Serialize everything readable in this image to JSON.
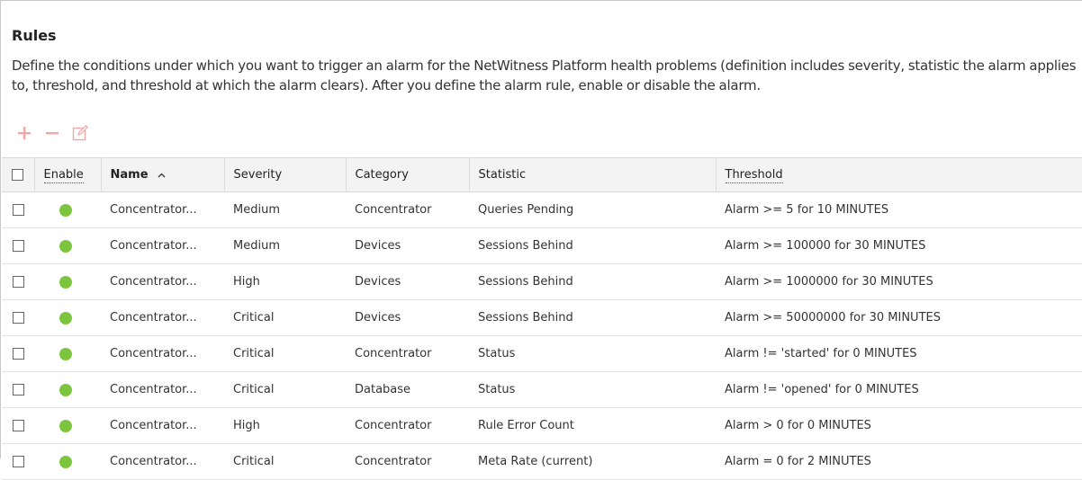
{
  "page": {
    "title": "Rules",
    "description": "Define the conditions under which you want to trigger an alarm for the NetWitness Platform health problems (definition includes severity, statistic the alarm applies to, threshold, and threshold at which the alarm clears). After you define the alarm rule, enable or disable the alarm."
  },
  "toolbar": {
    "icons": [
      "plus-icon",
      "minus-icon",
      "edit-icon"
    ],
    "icon_color": "#f2a7a7"
  },
  "colors": {
    "enabled_dot": "#7ec53f"
  },
  "table": {
    "columns": {
      "enable": "Enable",
      "name": "Name",
      "severity": "Severity",
      "category": "Category",
      "statistic": "Statistic",
      "threshold": "Threshold"
    },
    "sort_icon": "chevron-up-icon",
    "rows": [
      {
        "name": "Concentrator...",
        "severity": "Medium",
        "category": "Concentrator",
        "statistic": "Queries Pending",
        "threshold": "Alarm >= 5 for 10 MINUTES"
      },
      {
        "name": "Concentrator...",
        "severity": "Medium",
        "category": "Devices",
        "statistic": "Sessions Behind",
        "threshold": "Alarm >= 100000 for 30 MINUTES"
      },
      {
        "name": "Concentrator...",
        "severity": "High",
        "category": "Devices",
        "statistic": "Sessions Behind",
        "threshold": "Alarm >= 1000000 for 30 MINUTES"
      },
      {
        "name": "Concentrator...",
        "severity": "Critical",
        "category": "Devices",
        "statistic": "Sessions Behind",
        "threshold": "Alarm >= 50000000 for 30 MINUTES"
      },
      {
        "name": "Concentrator...",
        "severity": "Critical",
        "category": "Concentrator",
        "statistic": "Status",
        "threshold": "Alarm != 'started' for 0 MINUTES"
      },
      {
        "name": "Concentrator...",
        "severity": "Critical",
        "category": "Database",
        "statistic": "Status",
        "threshold": "Alarm != 'opened' for 0 MINUTES"
      },
      {
        "name": "Concentrator...",
        "severity": "High",
        "category": "Concentrator",
        "statistic": "Rule Error Count",
        "threshold": "Alarm > 0 for 0 MINUTES"
      },
      {
        "name": "Concentrator...",
        "severity": "Critical",
        "category": "Concentrator",
        "statistic": "Meta Rate (current)",
        "threshold": "Alarm = 0 for 2 MINUTES"
      }
    ]
  }
}
